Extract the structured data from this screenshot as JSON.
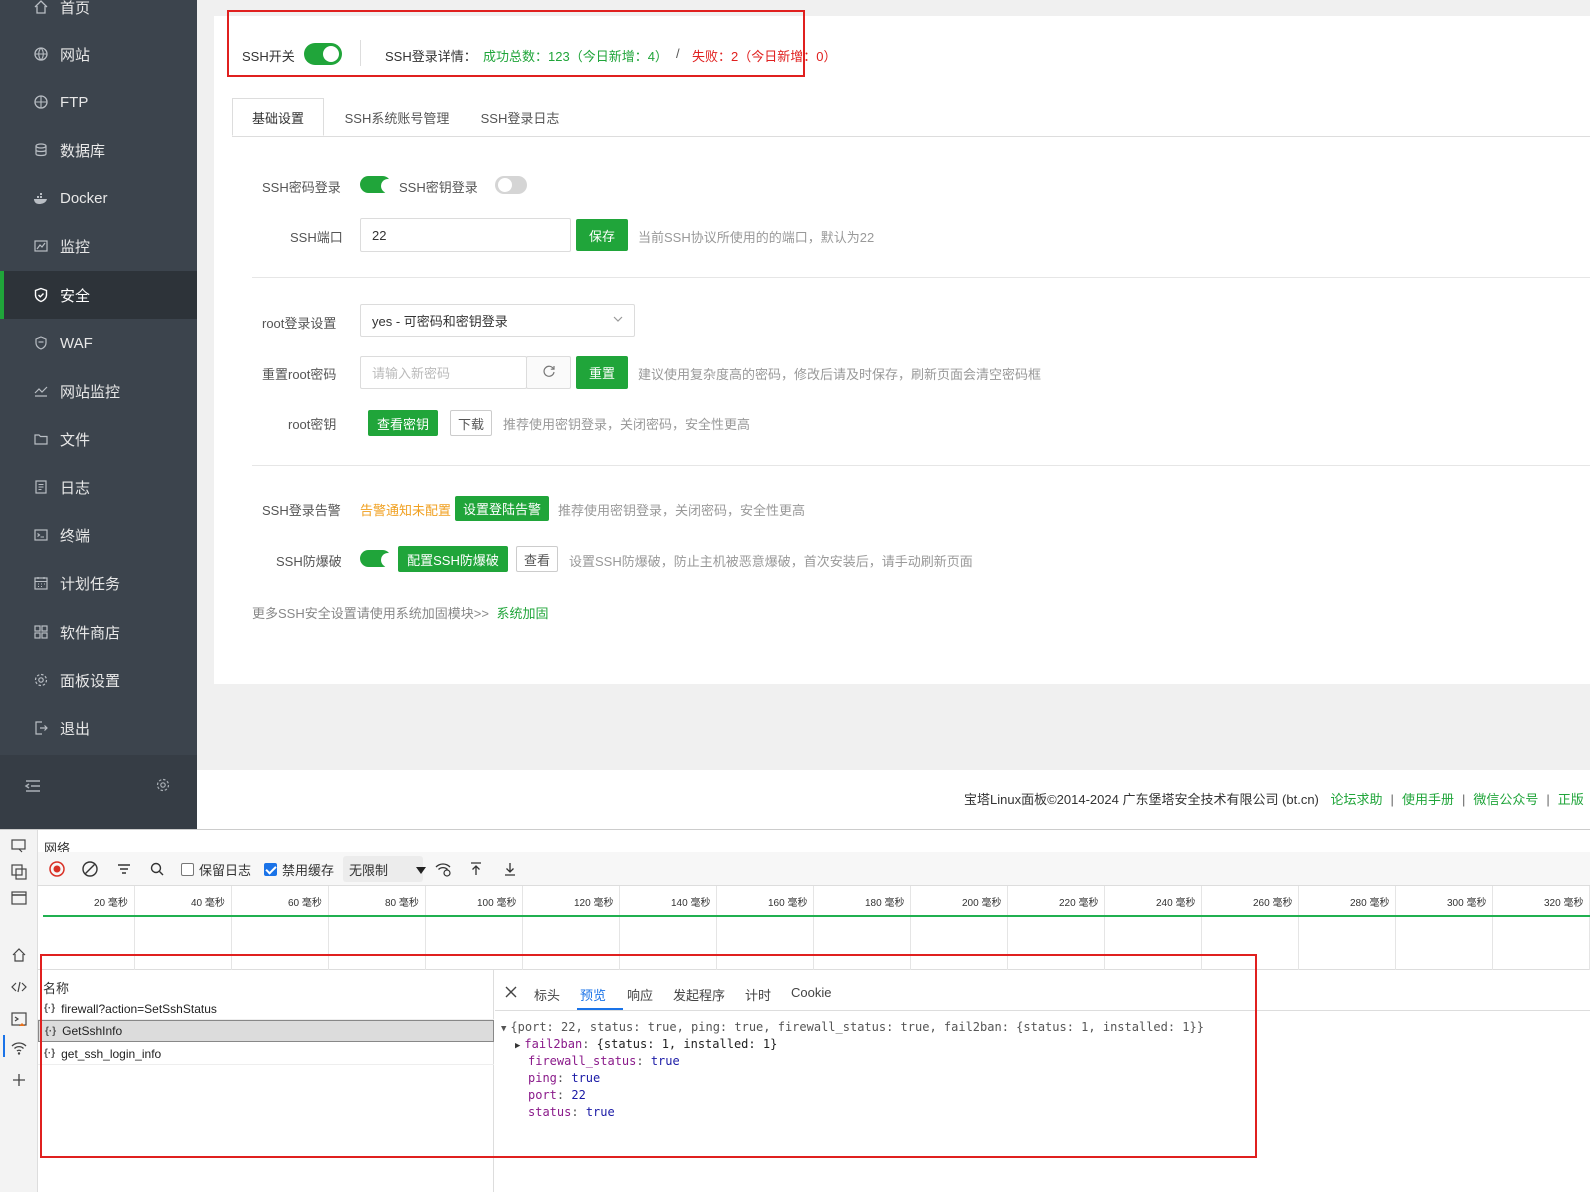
{
  "sidebar": {
    "items": [
      {
        "label": "首页",
        "icon": "home-icon"
      },
      {
        "label": "网站",
        "icon": "globe-icon"
      },
      {
        "label": "FTP",
        "icon": "ftp-globe-icon"
      },
      {
        "label": "数据库",
        "icon": "database-icon"
      },
      {
        "label": "Docker",
        "icon": "docker-icon"
      },
      {
        "label": "监控",
        "icon": "monitor-chart-icon"
      },
      {
        "label": "安全",
        "icon": "shield-icon"
      },
      {
        "label": "WAF",
        "icon": "waf-shield-icon"
      },
      {
        "label": "网站监控",
        "icon": "site-monitor-icon"
      },
      {
        "label": "文件",
        "icon": "folder-icon"
      },
      {
        "label": "日志",
        "icon": "log-icon"
      },
      {
        "label": "终端",
        "icon": "terminal-icon"
      },
      {
        "label": "计划任务",
        "icon": "calendar-icon"
      },
      {
        "label": "软件商店",
        "icon": "apps-grid-icon"
      },
      {
        "label": "面板设置",
        "icon": "gear-icon"
      },
      {
        "label": "退出",
        "icon": "logout-icon"
      }
    ],
    "active": "安全"
  },
  "ssh_header": {
    "switch_label": "SSH开关",
    "switch_on": true,
    "login_details_label": "SSH登录详情：",
    "success_text": "成功总数：123（今日新增：4）",
    "slash": "/",
    "fail_text": "失败：2（今日新增：0）"
  },
  "tabs": [
    "基础设置",
    "SSH系统账号管理",
    "SSH登录日志"
  ],
  "active_tab": "基础设置",
  "basic": {
    "pw_login_label": "SSH密码登录",
    "pw_login_on": true,
    "key_login_label": "SSH密钥登录",
    "key_login_on": false,
    "port_label": "SSH端口",
    "port_value": "22",
    "save_label": "保存",
    "port_hint": "当前SSH协议所使用的的端口，默认为22",
    "root_login_label": "root登录设置",
    "root_login_value": "yes - 可密码和密钥登录",
    "reset_pw_label": "重置root密码",
    "reset_pw_placeholder": "请输入新密码",
    "reset_label": "重置",
    "reset_hint": "建议使用复杂度高的密码，修改后请及时保存，刷新页面会清空密码框",
    "root_key_label": "root密钥",
    "view_key_label": "查看密钥",
    "download_label": "下载",
    "root_key_hint": "推荐使用密钥登录，关闭密码，安全性更高",
    "alarm_label": "SSH登录告警",
    "alarm_status": "告警通知未配置",
    "alarm_button": "设置登陆告警",
    "alarm_hint": "推荐使用密钥登录，关闭密码，安全性更高",
    "brute_label": "SSH防爆破",
    "brute_on": true,
    "brute_button": "配置SSH防爆破",
    "brute_view": "查看",
    "brute_hint": "设置SSH防爆破，防止主机被恶意爆破，首次安装后，请手动刷新页面",
    "more_text": "更多SSH安全设置请使用系统加固模块>>",
    "more_link": "系统加固"
  },
  "footer": {
    "copyright": "宝塔Linux面板©2014-2024 广东堡塔安全技术有限公司 (bt.cn)",
    "links": [
      "论坛求助",
      "使用手册",
      "微信公众号",
      "正版"
    ]
  },
  "devtools": {
    "panel_title": "网络",
    "preserve_log": "保留日志",
    "preserve_log_checked": false,
    "disable_cache": "禁用缓存",
    "disable_cache_checked": true,
    "throttle": "无限制",
    "timeline_labels": [
      "20 毫秒",
      "40 毫秒",
      "60 毫秒",
      "80 毫秒",
      "100 毫秒",
      "120 毫秒",
      "140 毫秒",
      "160 毫秒",
      "180 毫秒",
      "200 毫秒",
      "220 毫秒",
      "240 毫秒",
      "260 毫秒",
      "280 毫秒",
      "300 毫秒",
      "320 毫秒"
    ],
    "name_header": "名称",
    "requests": [
      "firewall?action=SetSshStatus",
      "GetSshInfo",
      "get_ssh_login_info"
    ],
    "selected_request": "GetSshInfo",
    "detail_tabs": [
      "标头",
      "预览",
      "响应",
      "发起程序",
      "计时",
      "Cookie"
    ],
    "active_detail_tab": "预览",
    "preview": {
      "summary": "{port: 22, status: true, ping: true, firewall_status: true, fail2ban: {status: 1, installed: 1}}",
      "fail2ban_key": "fail2ban",
      "fail2ban_val": "{status: 1, installed: 1}",
      "firewall_status_key": "firewall_status",
      "firewall_status_val": "true",
      "ping_key": "ping",
      "ping_val": "true",
      "port_key": "port",
      "port_val": "22",
      "status_key": "status",
      "status_val": "true"
    }
  }
}
